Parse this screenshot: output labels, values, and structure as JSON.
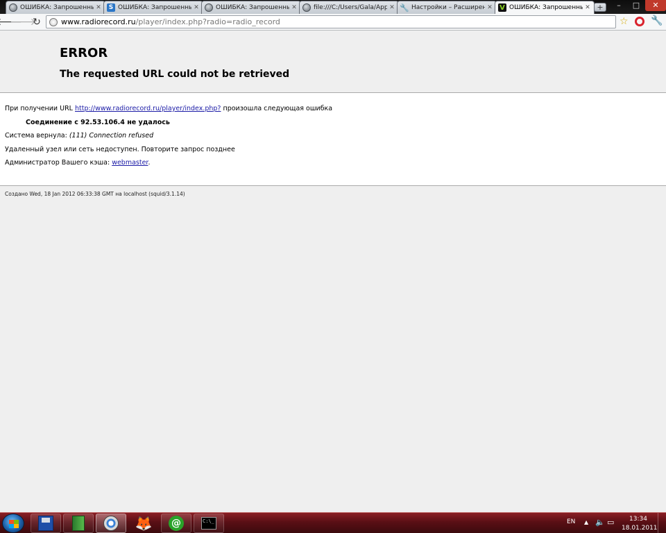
{
  "tabs": [
    {
      "label": "ОШИБКА: Запрошенный",
      "icon": "globe-icon",
      "active": false
    },
    {
      "label": "ОШИБКА: Запрошенный",
      "icon": "s-icon",
      "active": false
    },
    {
      "label": "ОШИБКА: Запрошенный",
      "icon": "globe-icon",
      "active": false
    },
    {
      "label": "file:///C:/Users/Gala/AppD",
      "icon": "globe-icon",
      "active": false
    },
    {
      "label": "Настройки – Расширени",
      "icon": "wrench-icon",
      "active": false
    },
    {
      "label": "ОШИБКА: Запрошенный",
      "icon": "v-icon",
      "active": true
    }
  ],
  "toolbar": {
    "url_host": "www.radiorecord.ru",
    "url_path": "/player/index.php?radio=radio_record"
  },
  "page": {
    "title": "ERROR",
    "subtitle": "The requested URL could not be retrieved",
    "line1_prefix": "При получении URL ",
    "line1_link": "http://www.radiorecord.ru/player/index.php?",
    "line1_suffix": " произошла следующая ошибка",
    "line2": "Соединение с 92.53.106.4 не удалось",
    "line3_prefix": "Система вернула: ",
    "line3_italic": "(111) Connection refused",
    "line4": "Удаленный узел или сеть недоступен. Повторите запрос позднее",
    "line5_prefix": "Администратор Вашего кэша: ",
    "line5_link": "webmaster",
    "line5_suffix": ".",
    "footer": "Создано Wed, 18 Jan 2012 06:33:38 GMT на localhost (squid/3.1.14)"
  },
  "taskbar": {
    "apps": [
      "floppy-icon",
      "book-icon",
      "chrome-icon",
      "fox-icon",
      "at-icon",
      "cmd-icon"
    ],
    "cmd_text": "C:\\_",
    "language": "EN",
    "time": "13:34",
    "date": "18.01.2011"
  },
  "colors": {
    "link": "#1a1aa6",
    "page_bg": "#efefef",
    "taskbar": "#5a0f15"
  }
}
